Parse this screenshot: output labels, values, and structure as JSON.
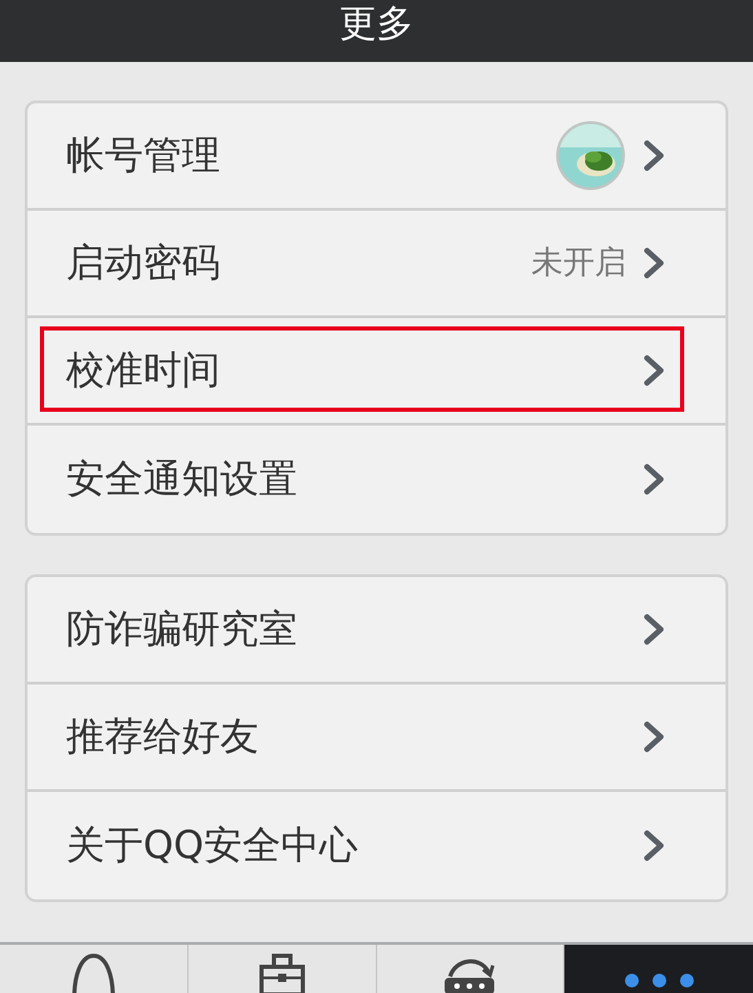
{
  "header": {
    "title": "更多"
  },
  "groups": [
    {
      "items": [
        {
          "label": "帐号管理",
          "kind": "avatar",
          "highlighted": false
        },
        {
          "label": "启动密码",
          "kind": "value",
          "value": "未开启",
          "highlighted": false
        },
        {
          "label": "校准时间",
          "kind": "plain",
          "highlighted": true
        },
        {
          "label": "安全通知设置",
          "kind": "plain",
          "highlighted": false
        }
      ]
    },
    {
      "items": [
        {
          "label": "防诈骗研究室",
          "kind": "plain",
          "highlighted": false
        },
        {
          "label": "推荐给好友",
          "kind": "plain",
          "highlighted": false
        },
        {
          "label": "关于QQ安全中心",
          "kind": "plain",
          "highlighted": false
        }
      ]
    }
  ],
  "tabs": [
    {
      "selected": false
    },
    {
      "selected": false
    },
    {
      "selected": false
    },
    {
      "selected": true
    }
  ]
}
